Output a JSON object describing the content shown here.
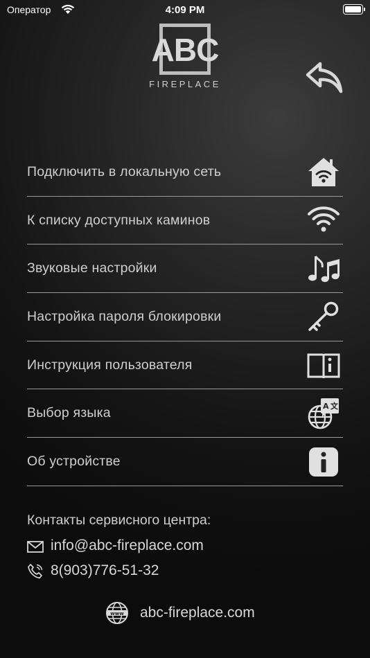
{
  "status_bar": {
    "carrier": "Оператор",
    "time": "4:09 PM"
  },
  "logo": {
    "text": "ABC",
    "subtitle": "FIREPLACE"
  },
  "menu": {
    "items": [
      {
        "label": "Подключить в локальную сеть",
        "icon": "home-wifi-icon"
      },
      {
        "label": "К списку доступных каминов",
        "icon": "wifi-icon"
      },
      {
        "label": "Звуковые настройки",
        "icon": "music-notes-icon"
      },
      {
        "label": "Настройка пароля блокировки",
        "icon": "key-icon"
      },
      {
        "label": "Инструкция пользователя",
        "icon": "book-info-icon"
      },
      {
        "label": "Выбор языка",
        "icon": "globe-language-icon"
      },
      {
        "label": "Об устройстве",
        "icon": "info-icon"
      }
    ]
  },
  "contacts": {
    "title": "Контакты сервисного центра:",
    "email": "info@abc-fireplace.com",
    "phone": "8(903)776-51-32"
  },
  "website": {
    "url": "abc-fireplace.com",
    "icon_label": "www"
  },
  "colors": {
    "text": "#cfcfcf",
    "icon": "#e0e0e0",
    "divider": "#9a9a9a",
    "background_dark": "#0c0c0c",
    "background_light": "#3c3c3c"
  }
}
